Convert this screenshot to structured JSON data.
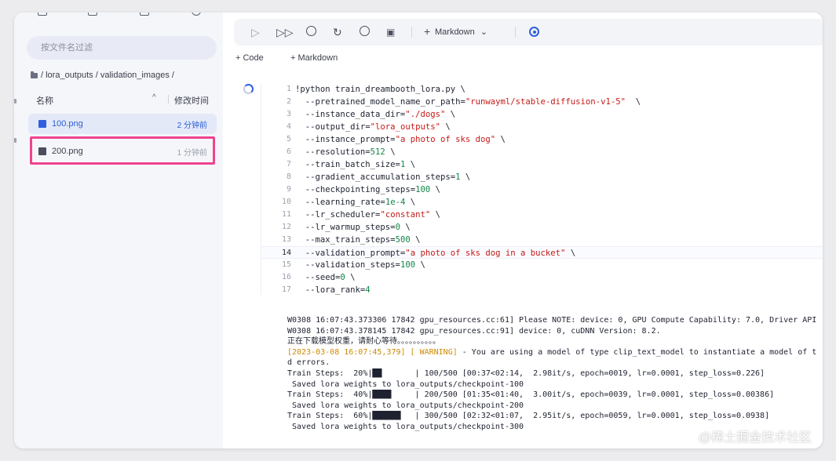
{
  "sidebar": {
    "filter_placeholder": "按文件名过滤",
    "breadcrumb": "/ lora_outputs / validation_images /",
    "columns": {
      "name": "名称",
      "time": "修改时间"
    },
    "files": [
      {
        "name": "100.png",
        "time": "2 分钟前"
      },
      {
        "name": "200.png",
        "time": "1 分钟前"
      }
    ]
  },
  "toolbar": {
    "cell_type": "Markdown"
  },
  "actions": {
    "add_code": "+ Code",
    "add_markdown": "+ Markdown"
  },
  "code_lines": [
    [
      [
        "t",
        "!python train_dreambooth_lora.py \\"
      ]
    ],
    [
      [
        "t",
        "  --pretrained_model_name_or_path="
      ],
      [
        "s",
        "\"runwayml/stable-diffusion-v1-5\""
      ],
      [
        "t",
        "  \\"
      ]
    ],
    [
      [
        "t",
        "  --instance_data_dir="
      ],
      [
        "s",
        "\"./dogs\""
      ],
      [
        "t",
        " \\"
      ]
    ],
    [
      [
        "t",
        "  --output_dir="
      ],
      [
        "s",
        "\"lora_outputs\""
      ],
      [
        "t",
        " \\"
      ]
    ],
    [
      [
        "t",
        "  --instance_prompt="
      ],
      [
        "s",
        "\"a photo of sks dog\""
      ],
      [
        "t",
        " \\"
      ]
    ],
    [
      [
        "t",
        "  --resolution="
      ],
      [
        "n",
        "512"
      ],
      [
        "t",
        " \\"
      ]
    ],
    [
      [
        "t",
        "  --train_batch_size="
      ],
      [
        "n",
        "1"
      ],
      [
        "t",
        " \\"
      ]
    ],
    [
      [
        "t",
        "  --gradient_accumulation_steps="
      ],
      [
        "n",
        "1"
      ],
      [
        "t",
        " \\"
      ]
    ],
    [
      [
        "t",
        "  --checkpointing_steps="
      ],
      [
        "n",
        "100"
      ],
      [
        "t",
        " \\"
      ]
    ],
    [
      [
        "t",
        "  --learning_rate="
      ],
      [
        "n",
        "1e-4"
      ],
      [
        "t",
        " \\"
      ]
    ],
    [
      [
        "t",
        "  --lr_scheduler="
      ],
      [
        "s",
        "\"constant\""
      ],
      [
        "t",
        " \\"
      ]
    ],
    [
      [
        "t",
        "  --lr_warmup_steps="
      ],
      [
        "n",
        "0"
      ],
      [
        "t",
        " \\"
      ]
    ],
    [
      [
        "t",
        "  --max_train_steps="
      ],
      [
        "n",
        "500"
      ],
      [
        "t",
        " \\"
      ]
    ],
    [
      [
        "t",
        "  --validation_prompt="
      ],
      [
        "s",
        "\"a photo of sks dog in a bucket\""
      ],
      [
        "t",
        " \\"
      ]
    ],
    [
      [
        "t",
        "  --validation_steps="
      ],
      [
        "n",
        "100"
      ],
      [
        "t",
        " \\"
      ]
    ],
    [
      [
        "t",
        "  --seed="
      ],
      [
        "n",
        "0"
      ],
      [
        "t",
        " \\"
      ]
    ],
    [
      [
        "t",
        "  --lora_rank="
      ],
      [
        "n",
        "4"
      ]
    ]
  ],
  "current_line": 14,
  "output_lines": [
    [
      [
        "t",
        "W0308 16:07:43.373306 17842 gpu_resources.cc:61] Please NOTE: device: 0, GPU Compute Capability: 7.0, Driver API"
      ]
    ],
    [
      [
        "t",
        "W0308 16:07:43.378145 17842 gpu_resources.cc:91] device: 0, cuDNN Version: 8.2."
      ]
    ],
    [
      [
        "t",
        "正在下载模型权重，请耐心等待。。。。。。。。。。"
      ]
    ],
    [
      [
        "w",
        "[2023-03-08 16:07:45,379] [ WARNING]"
      ],
      [
        "t",
        " - You are using a model of type clip_text_model to instantiate a model of t"
      ]
    ],
    [
      [
        "t",
        "d errors."
      ]
    ],
    [
      [
        "t",
        "Train Steps:  20%|██       | 100/500 [00:37<02:14,  2.98it/s, epoch=0019, lr=0.0001, step_loss=0.226]"
      ]
    ],
    [
      [
        "t",
        " Saved lora weights to lora_outputs/checkpoint-100"
      ]
    ],
    [
      [
        "t",
        "Train Steps:  40%|████     | 200/500 [01:35<01:40,  3.00it/s, epoch=0039, lr=0.0001, step_loss=0.00386]"
      ]
    ],
    [
      [
        "t",
        " Saved lora weights to lora_outputs/checkpoint-200"
      ]
    ],
    [
      [
        "t",
        "Train Steps:  60%|██████   | 300/500 [02:32<01:07,  2.95it/s, epoch=0059, lr=0.0001, step_loss=0.0938]"
      ]
    ],
    [
      [
        "t",
        " Saved lora weights to lora_outputs/checkpoint-300"
      ]
    ]
  ],
  "watermark": "@稀土掘金技术社区",
  "colors": {
    "accent": "#2f5fe0",
    "highlight_border": "#f0438e",
    "string": "#c41a16",
    "number": "#11864a",
    "warning": "#d08a00"
  }
}
